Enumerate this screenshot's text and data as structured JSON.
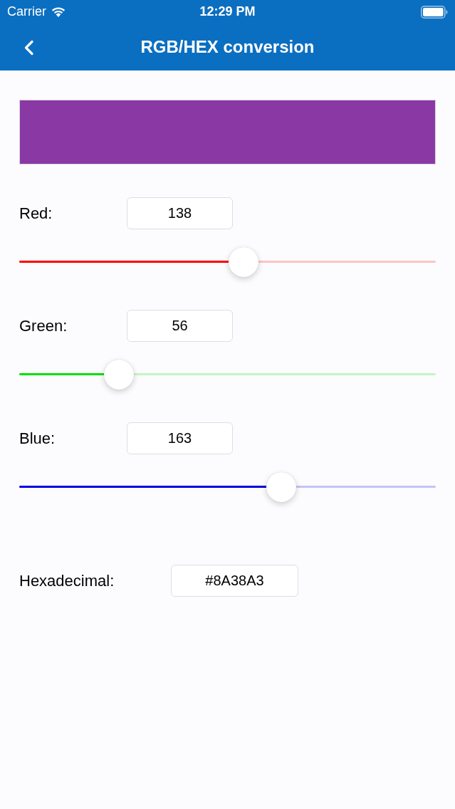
{
  "status_bar": {
    "carrier": "Carrier",
    "time": "12:29 PM"
  },
  "nav_bar": {
    "title": "RGB/HEX conversion"
  },
  "preview": {
    "color": "#8a38a3"
  },
  "channels": [
    {
      "label": "Red:",
      "value": "138",
      "level": 0.541,
      "color": "#ff0000"
    },
    {
      "label": "Green:",
      "value": "56",
      "level": 0.22,
      "color": "#00e000"
    },
    {
      "label": "Blue:",
      "value": "163",
      "level": 0.639,
      "color": "#0000e0"
    }
  ],
  "hex": {
    "label": "Hexadecimal:",
    "value": "#8A38A3"
  }
}
